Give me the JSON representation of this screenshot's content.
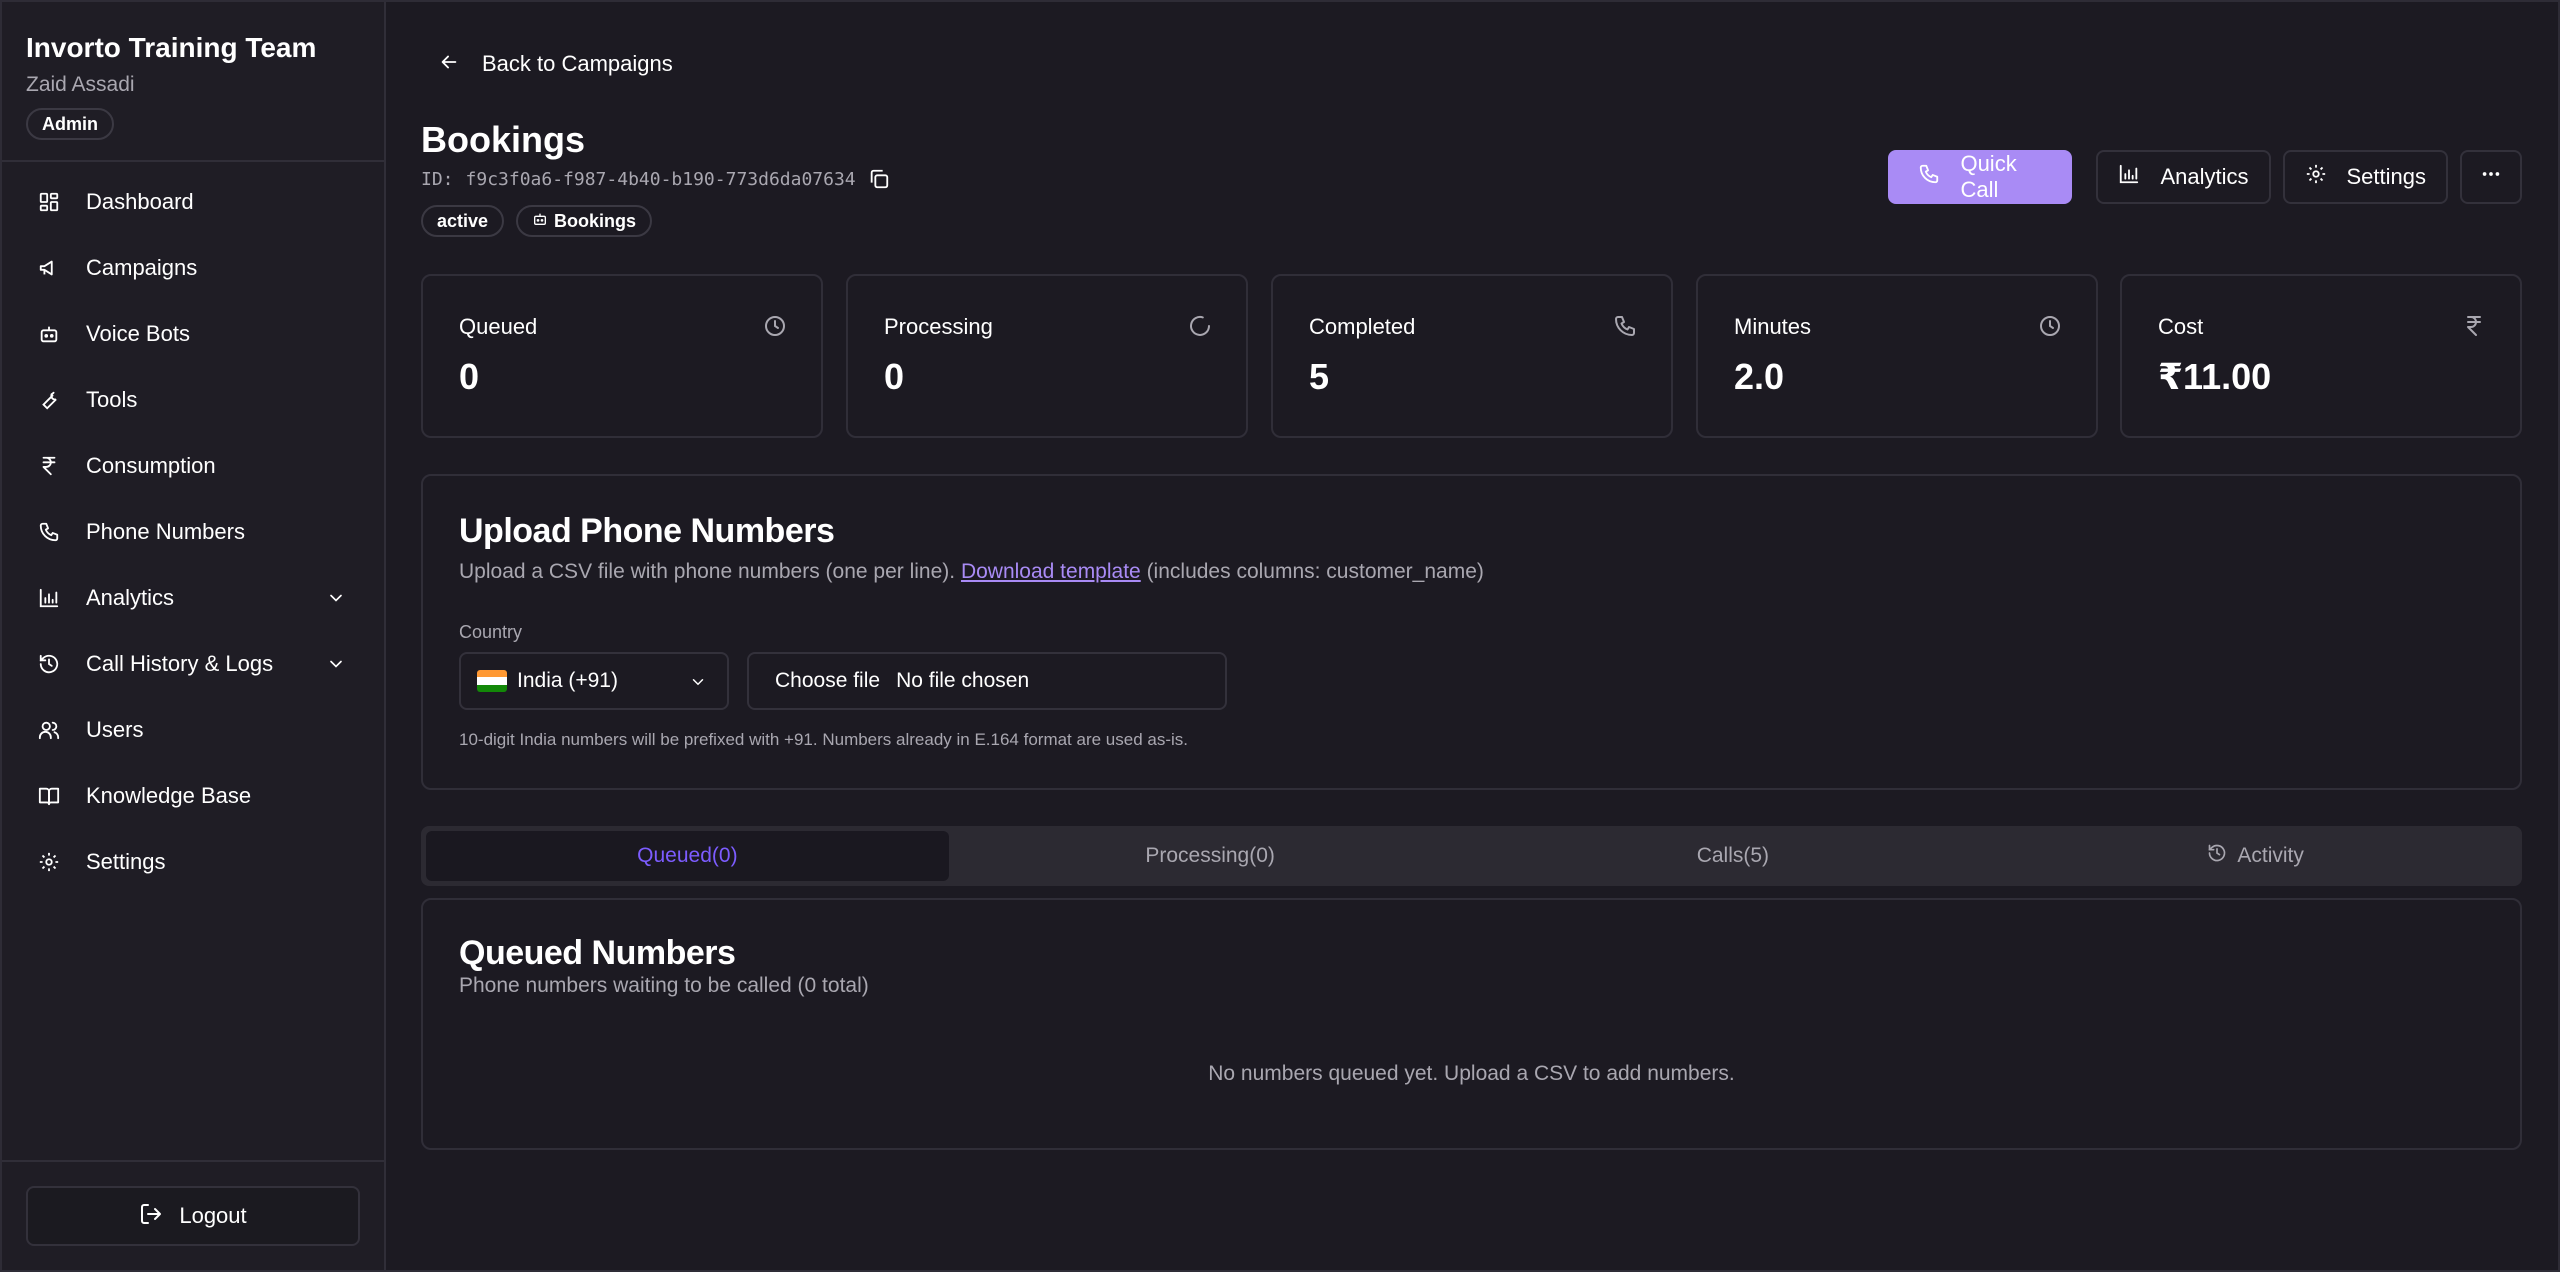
{
  "sidebar": {
    "org_name": "Invorto Training Team",
    "user_name": "Zaid Assadi",
    "role": "Admin",
    "items": [
      {
        "label": "Dashboard",
        "icon": "dashboard-icon"
      },
      {
        "label": "Campaigns",
        "icon": "megaphone-icon"
      },
      {
        "label": "Voice Bots",
        "icon": "bot-icon"
      },
      {
        "label": "Tools",
        "icon": "wrench-icon"
      },
      {
        "label": "Consumption",
        "icon": "rupee-icon"
      },
      {
        "label": "Phone Numbers",
        "icon": "phone-icon"
      },
      {
        "label": "Analytics",
        "icon": "bar-chart-icon",
        "expandable": true
      },
      {
        "label": "Call History & Logs",
        "icon": "history-icon",
        "expandable": true
      },
      {
        "label": "Users",
        "icon": "users-icon"
      },
      {
        "label": "Knowledge Base",
        "icon": "book-icon"
      },
      {
        "label": "Settings",
        "icon": "gear-icon"
      }
    ],
    "logout_label": "Logout"
  },
  "header": {
    "back_label": "Back to Campaigns",
    "title": "Bookings",
    "id_prefix": "ID:",
    "id_value": "f9c3f0a6-f987-4b40-b190-773d6da07634",
    "tags": [
      {
        "label": "active"
      },
      {
        "label": "Bookings",
        "icon": "bot-icon"
      }
    ],
    "actions": {
      "quick_call": "Quick Call",
      "analytics": "Analytics",
      "settings": "Settings"
    }
  },
  "stats": [
    {
      "label": "Queued",
      "value": "0",
      "icon": "clock-icon"
    },
    {
      "label": "Processing",
      "value": "0",
      "icon": "spinner-icon"
    },
    {
      "label": "Completed",
      "value": "5",
      "icon": "phone-icon"
    },
    {
      "label": "Minutes",
      "value": "2.0",
      "icon": "clock-icon"
    },
    {
      "label": "Cost",
      "value": "₹11.00",
      "icon": "rupee-icon"
    }
  ],
  "upload": {
    "title": "Upload Phone Numbers",
    "desc_before": "Upload a CSV file with phone numbers (one per line). ",
    "template_link": "Download template",
    "desc_after": " (includes columns: customer_name)",
    "country_label": "Country",
    "country_value": "India (+91)",
    "choose_file": "Choose file",
    "no_file": "No file chosen",
    "hint": "10-digit India numbers will be prefixed with +91. Numbers already in E.164 format are used as-is."
  },
  "tabs": [
    {
      "label": "Queued(0)",
      "active": true
    },
    {
      "label": "Processing(0)"
    },
    {
      "label": "Calls(5)"
    },
    {
      "label": "Activity",
      "icon": "history-icon"
    }
  ],
  "queued": {
    "title": "Queued Numbers",
    "subtitle": "Phone numbers waiting to be called (0 total)",
    "empty": "No numbers queued yet. Upload a CSV to add numbers."
  },
  "colors": {
    "background": "#1c1a22",
    "accent": "#a98bf5",
    "active_tab_text": "#7c5cff",
    "muted_text": "#a9a7b0"
  }
}
